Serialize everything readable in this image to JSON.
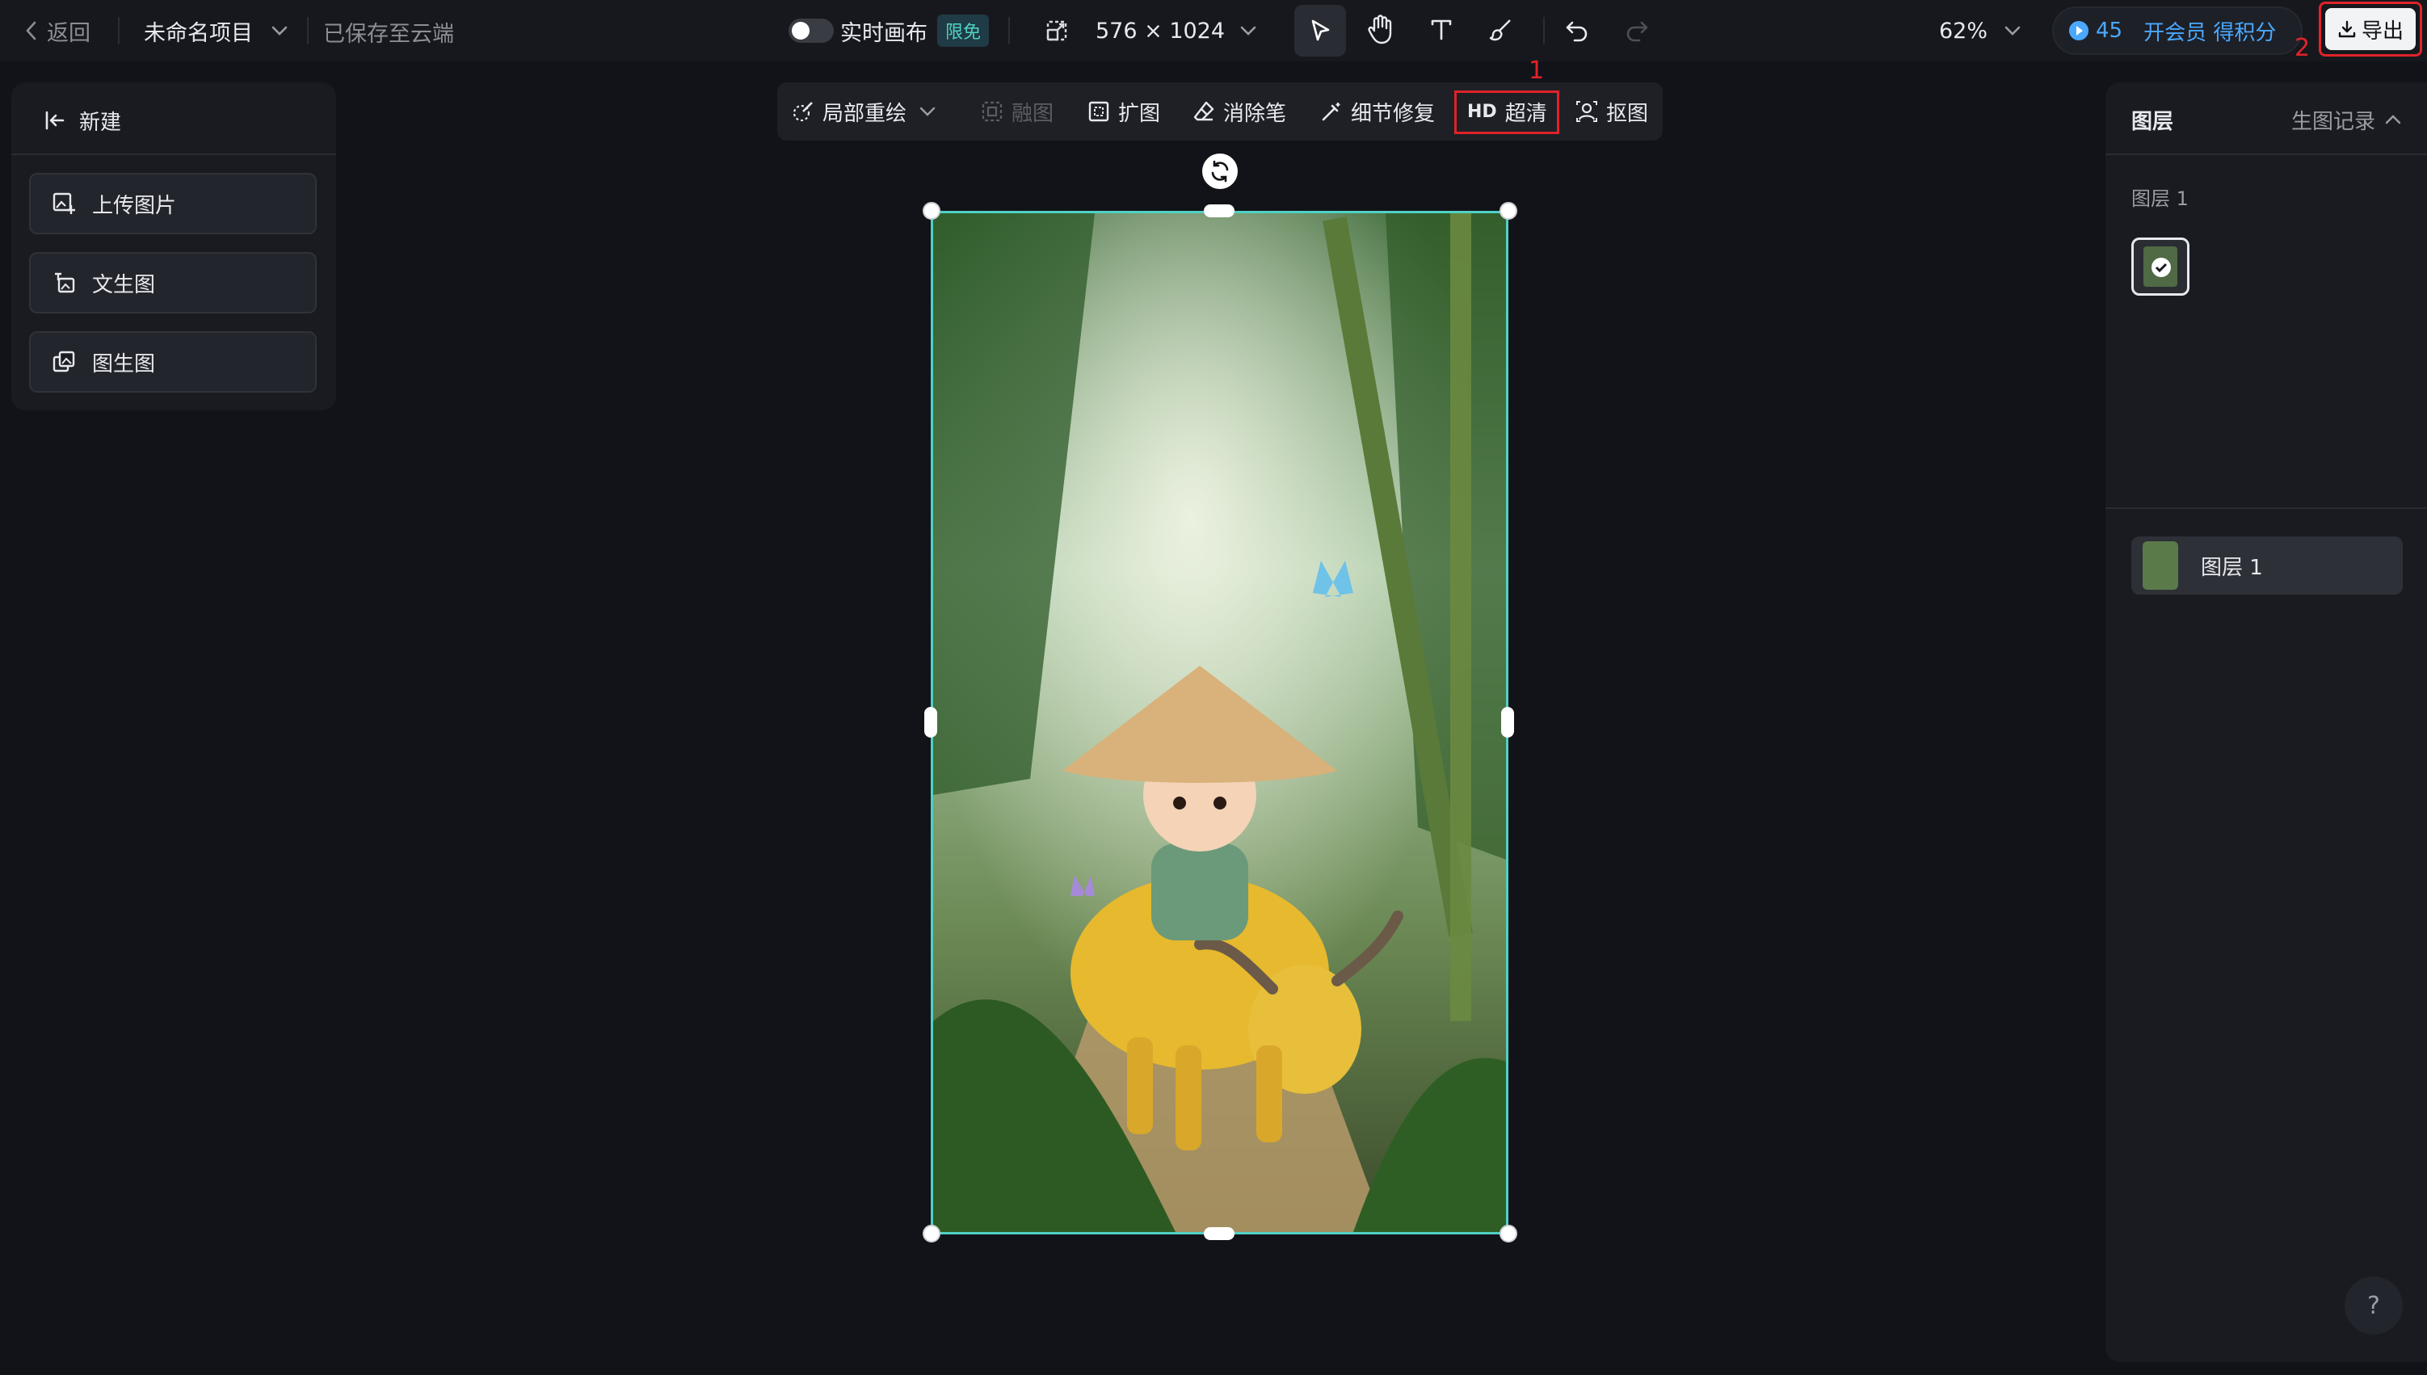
{
  "topbar": {
    "back_label": "返回",
    "project_name": "未命名项目",
    "save_status": "已保存至云端",
    "realtime_label": "实时画布",
    "free_badge": "限免",
    "canvas_size": "576 × 1024",
    "zoom": "62%",
    "credits": "45",
    "vip_label": "开会员 得积分",
    "export_label": "导出"
  },
  "annotations": {
    "num1": "1",
    "num2": "2"
  },
  "tools": {
    "inpaint": "局部重绘",
    "blend": "融图",
    "expand": "扩图",
    "eraser": "消除笔",
    "detail_fix": "细节修复",
    "hd_badge": "HD",
    "upscale": "超清",
    "cutout": "抠图"
  },
  "left_panel": {
    "new_label": "新建",
    "items": [
      {
        "label": "上传图片"
      },
      {
        "label": "文生图"
      },
      {
        "label": "图生图"
      }
    ]
  },
  "right_panel": {
    "layers_tab": "图层",
    "history_tab": "生图记录",
    "group_title": "图层 1",
    "layer_item": "图层 1",
    "help": "?"
  },
  "colors": {
    "accent_teal": "#4fd1c5",
    "vip_blue": "#4aa8ff",
    "highlight_red": "#e0232a",
    "background": "#121318"
  }
}
